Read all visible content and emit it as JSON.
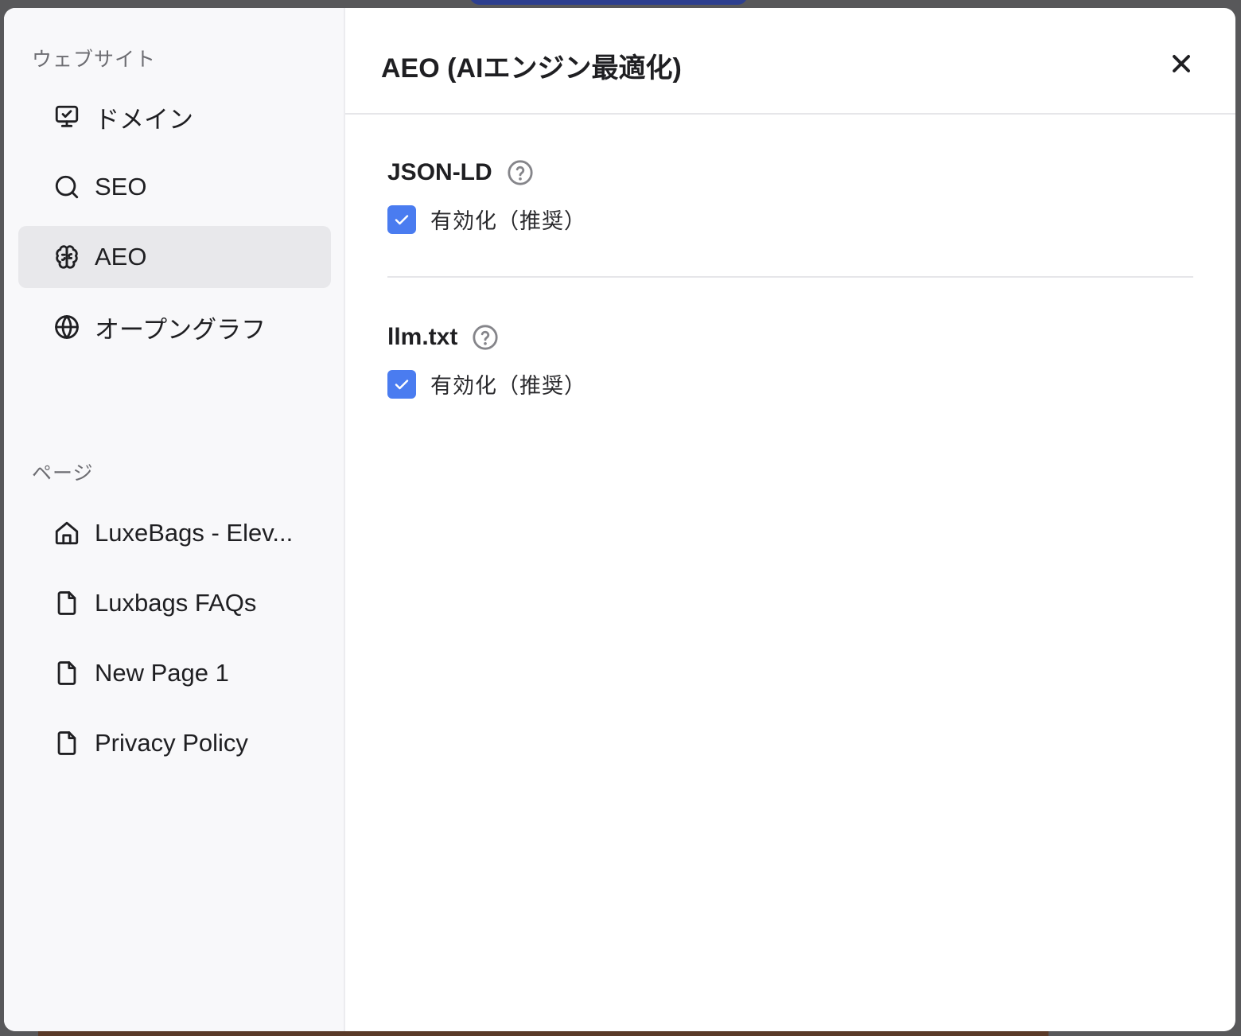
{
  "sidebar": {
    "website_section": "ウェブサイト",
    "website_items": [
      {
        "label": "ドメイン",
        "icon": "monitor-icon"
      },
      {
        "label": "SEO",
        "icon": "search-icon"
      },
      {
        "label": "AEO",
        "icon": "brain-icon",
        "active": true
      },
      {
        "label": "オープングラフ",
        "icon": "globe-icon"
      }
    ],
    "pages_section": "ページ",
    "page_items": [
      {
        "label": "LuxeBags - Elev...",
        "icon": "home-icon"
      },
      {
        "label": "Luxbags FAQs",
        "icon": "file-icon"
      },
      {
        "label": "New Page 1",
        "icon": "file-icon"
      },
      {
        "label": "Privacy Policy",
        "icon": "file-icon"
      }
    ]
  },
  "header": {
    "title": "AEO (AIエンジン最適化)"
  },
  "settings": [
    {
      "title": "JSON-LD",
      "checkbox_label": "有効化（推奨）",
      "checked": true
    },
    {
      "title": "llm.txt",
      "checkbox_label": "有効化（推奨）",
      "checked": true
    }
  ],
  "colors": {
    "checkbox_accent": "#4a7cf0",
    "sidebar_bg": "#f8f8fa",
    "active_item_bg": "#e8e8eb"
  }
}
